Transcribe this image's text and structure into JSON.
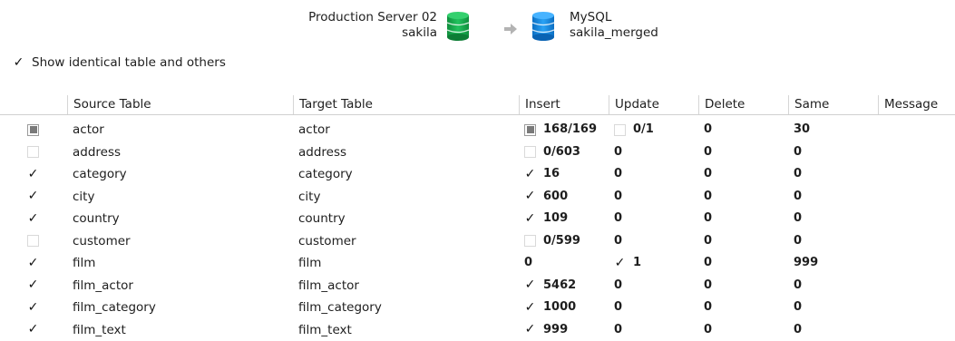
{
  "header": {
    "source": {
      "server": "Production Server 02",
      "schema": "sakila",
      "icon": "green-database-icon",
      "color": "#1db954"
    },
    "target": {
      "server": "MySQL",
      "schema": "sakila_merged",
      "icon": "blue-database-icon",
      "color": "#1a8ee6"
    },
    "arrow_icon": "right-arrow-icon"
  },
  "show_identical": {
    "label": "Show identical table and others",
    "checked": true
  },
  "columns": [
    "",
    "Source Table",
    "Target Table",
    "Insert",
    "Update",
    "Delete",
    "Same",
    "Message"
  ],
  "rows": [
    {
      "state": "partial",
      "source": "actor",
      "target": "actor",
      "insert": {
        "cb": "partial",
        "text": "168/169"
      },
      "update": {
        "cb": "unchecked",
        "text": "0/1"
      },
      "delete": "0",
      "same": "30",
      "message": ""
    },
    {
      "state": "unchecked",
      "source": "address",
      "target": "address",
      "insert": {
        "cb": "unchecked",
        "text": "0/603"
      },
      "update": {
        "cb": "none",
        "text": "0"
      },
      "delete": "0",
      "same": "0",
      "message": ""
    },
    {
      "state": "checked",
      "source": "category",
      "target": "category",
      "insert": {
        "cb": "checked",
        "text": "16"
      },
      "update": {
        "cb": "none",
        "text": "0"
      },
      "delete": "0",
      "same": "0",
      "message": ""
    },
    {
      "state": "checked",
      "source": "city",
      "target": "city",
      "insert": {
        "cb": "checked",
        "text": "600"
      },
      "update": {
        "cb": "none",
        "text": "0"
      },
      "delete": "0",
      "same": "0",
      "message": ""
    },
    {
      "state": "checked",
      "source": "country",
      "target": "country",
      "insert": {
        "cb": "checked",
        "text": "109"
      },
      "update": {
        "cb": "none",
        "text": "0"
      },
      "delete": "0",
      "same": "0",
      "message": ""
    },
    {
      "state": "unchecked",
      "source": "customer",
      "target": "customer",
      "insert": {
        "cb": "unchecked",
        "text": "0/599"
      },
      "update": {
        "cb": "none",
        "text": "0"
      },
      "delete": "0",
      "same": "0",
      "message": ""
    },
    {
      "state": "checked",
      "source": "film",
      "target": "film",
      "insert": {
        "cb": "none",
        "text": "0"
      },
      "update": {
        "cb": "checked",
        "text": "1"
      },
      "delete": "0",
      "same": "999",
      "message": ""
    },
    {
      "state": "checked",
      "source": "film_actor",
      "target": "film_actor",
      "insert": {
        "cb": "checked",
        "text": "5462"
      },
      "update": {
        "cb": "none",
        "text": "0"
      },
      "delete": "0",
      "same": "0",
      "message": ""
    },
    {
      "state": "checked",
      "source": "film_category",
      "target": "film_category",
      "insert": {
        "cb": "checked",
        "text": "1000"
      },
      "update": {
        "cb": "none",
        "text": "0"
      },
      "delete": "0",
      "same": "0",
      "message": ""
    },
    {
      "state": "checked",
      "source": "film_text",
      "target": "film_text",
      "insert": {
        "cb": "checked",
        "text": "999"
      },
      "update": {
        "cb": "none",
        "text": "0"
      },
      "delete": "0",
      "same": "0",
      "message": ""
    }
  ]
}
